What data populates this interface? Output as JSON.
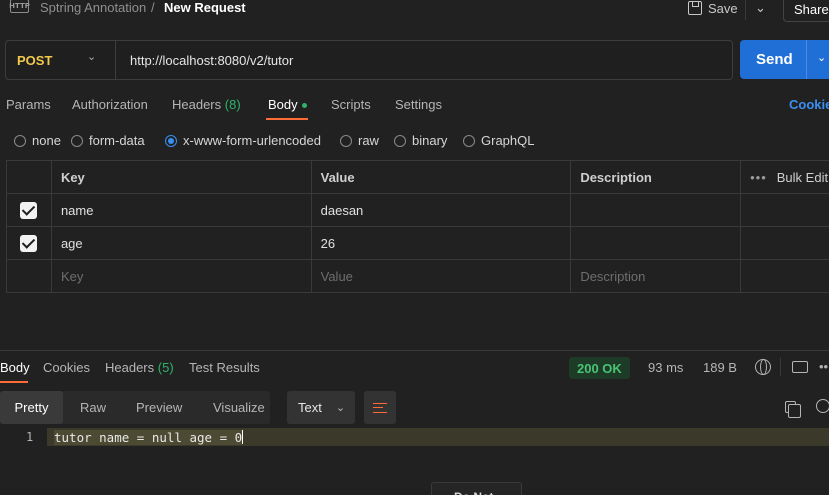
{
  "header": {
    "icon_label": "HTTP",
    "breadcrumb_parent": "Sptring Annotation",
    "breadcrumb_sep": "/",
    "title": "New Request",
    "save_label": "Save",
    "share_label": "Share"
  },
  "request": {
    "method": "POST",
    "url": "http://localhost:8080/v2/tutor",
    "send_label": "Send"
  },
  "tabs": {
    "params": "Params",
    "authorization": "Authorization",
    "headers": "Headers",
    "headers_count": "(8)",
    "body": "Body",
    "scripts": "Scripts",
    "settings": "Settings",
    "cookies": "Cookie"
  },
  "body_types": {
    "none": "none",
    "form_data": "form-data",
    "urlencoded": "x-www-form-urlencoded",
    "raw": "raw",
    "binary": "binary",
    "graphql": "GraphQL",
    "selected": "x-www-form-urlencoded"
  },
  "table": {
    "headers": {
      "key": "Key",
      "value": "Value",
      "description": "Description",
      "bulk_edit": "Bulk Edit",
      "more": "•••"
    },
    "rows": [
      {
        "key": "name",
        "value": "daesan",
        "description": "",
        "checked": true
      },
      {
        "key": "age",
        "value": "26",
        "description": "",
        "checked": true
      }
    ],
    "placeholders": {
      "key": "Key",
      "value": "Value",
      "description": "Description"
    }
  },
  "response": {
    "tabs": {
      "body": "Body",
      "cookies": "Cookies",
      "headers": "Headers",
      "headers_count": "(5)",
      "test_results": "Test Results"
    },
    "status": "200 OK",
    "time": "93 ms",
    "size": "189 B",
    "view_tabs": {
      "pretty": "Pretty",
      "raw": "Raw",
      "preview": "Preview",
      "visualize": "Visualize"
    },
    "format": "Text",
    "line_number": "1",
    "body_text": "tutor name = null age = 0",
    "bottom_popup": "Do Not..."
  },
  "colors": {
    "accent": "#ff6c37",
    "send": "#1f6fd6",
    "method": "#f2c94c",
    "status": "#49c475",
    "link": "#3b8ff0"
  }
}
